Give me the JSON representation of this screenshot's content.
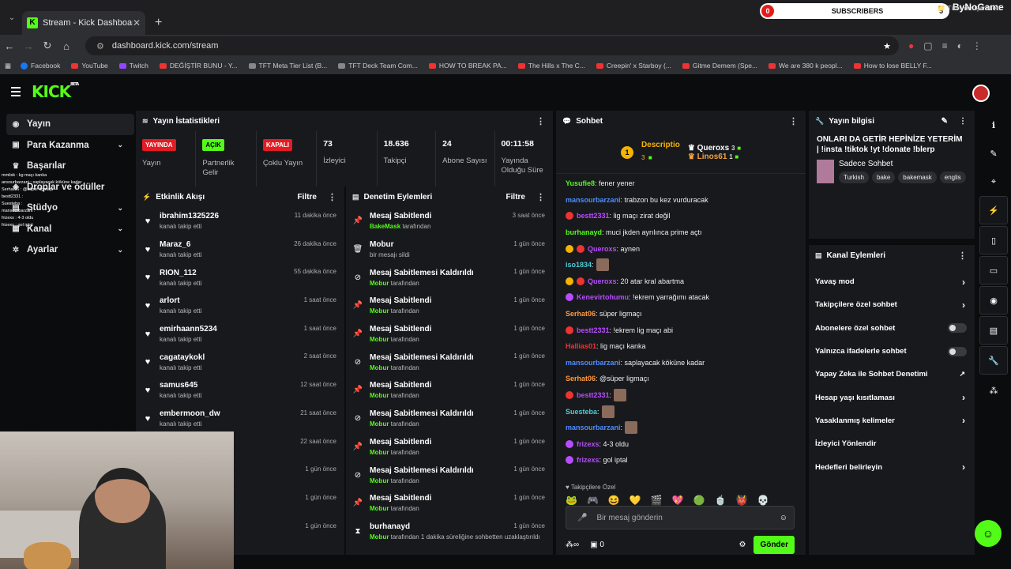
{
  "browser": {
    "tab_title": "Stream - Kick Dashboard",
    "url": "dashboard.kick.com/stream",
    "bookmarks": [
      {
        "label": "Facebook",
        "kind": "fb"
      },
      {
        "label": "YouTube",
        "kind": "yt"
      },
      {
        "label": "Twitch",
        "kind": "tw"
      },
      {
        "label": "DEĞİŞTİR BUNU - Y...",
        "kind": "yt"
      },
      {
        "label": "TFT Meta Tier List (B...",
        "kind": "gl"
      },
      {
        "label": "TFT Deck Team Com...",
        "kind": "gl"
      },
      {
        "label": "HOW TO BREAK PA...",
        "kind": "yt"
      },
      {
        "label": "The Hills x The C...",
        "kind": "yt"
      },
      {
        "label": "Creepin' x Starboy (...",
        "kind": "yt"
      },
      {
        "label": "Gitme Demem (Spe...",
        "kind": "yt"
      },
      {
        "label": "We are 380 k peopl...",
        "kind": "yt"
      },
      {
        "label": "How to lose BELLY F...",
        "kind": "yt"
      }
    ],
    "all_bookmarks": "Tüm Yer İşaretleri",
    "subs_left": "0",
    "subs_label": "SUBSCRIBERS",
    "subs_right": "5",
    "brand": "ByNoGame"
  },
  "sidebar": [
    {
      "label": "Yayın",
      "icon": "broadcast-icon",
      "glyph": "◉",
      "active": true,
      "chev": false
    },
    {
      "label": "Para Kazanma",
      "icon": "money-icon",
      "glyph": "▣",
      "chev": true
    },
    {
      "label": "Başarılar",
      "icon": "trophy-icon",
      "glyph": "♛",
      "chev": false
    },
    {
      "label": "Droplar ve ödüller",
      "icon": "gift-icon",
      "glyph": "◈",
      "chev": false
    },
    {
      "label": "Stüdyo",
      "icon": "studio-icon",
      "glyph": "▤",
      "chev": true
    },
    {
      "label": "Kanal",
      "icon": "channel-icon",
      "glyph": "▦",
      "chev": true
    },
    {
      "label": "Ayarlar",
      "icon": "settings-gear-icon",
      "glyph": "✲",
      "chev": true
    }
  ],
  "stats_panel": {
    "title": "Yayın İstatistikleri",
    "items": [
      {
        "badge": "YAYINDA",
        "color": "red",
        "label": "Yayın"
      },
      {
        "badge": "AÇIK",
        "color": "green",
        "label": "Partnerlik Gelir"
      },
      {
        "badge": "KAPALI",
        "color": "red",
        "label": "Çoklu Yayın"
      }
    ],
    "numbers": [
      {
        "value": "73",
        "label": "İzleyici"
      },
      {
        "value": "18.636",
        "label": "Takipçi"
      },
      {
        "value": "24",
        "label": "Abone Sayısı"
      },
      {
        "value": "00:11:58",
        "label": "Yayında Olduğu Süre"
      }
    ]
  },
  "activity": {
    "title": "Etkinlik Akışı",
    "filter": "Filtre",
    "items": [
      {
        "name": "ibrahim1325226",
        "sub": "kanalı takip etti",
        "time": "11 dakika önce"
      },
      {
        "name": "Maraz_6",
        "sub": "kanalı takip etti",
        "time": "26 dakika önce"
      },
      {
        "name": "RION_112",
        "sub": "kanalı takip etti",
        "time": "55 dakika önce"
      },
      {
        "name": "arlort",
        "sub": "kanalı takip etti",
        "time": "1 saat önce"
      },
      {
        "name": "emirhaann5234",
        "sub": "kanalı takip etti",
        "time": "1 saat önce"
      },
      {
        "name": "cagataykokl",
        "sub": "kanalı takip etti",
        "time": "2 saat önce"
      },
      {
        "name": "samus645",
        "sub": "kanalı takip etti",
        "time": "12 saat önce"
      },
      {
        "name": "embermoon_dw",
        "sub": "kanalı takip etti",
        "time": "21 saat önce"
      },
      {
        "name": "",
        "sub": "",
        "time": "22 saat önce"
      },
      {
        "name": "",
        "sub": "",
        "time": "1 gün önce"
      },
      {
        "name": "",
        "sub": "",
        "time": "1 gün önce"
      },
      {
        "name": "",
        "sub": "",
        "time": "1 gün önce"
      }
    ]
  },
  "moderation": {
    "title": "Denetim Eylemleri",
    "filter": "Filtre",
    "items": [
      {
        "glyph": "📌",
        "icon": "pin-icon",
        "name": "Mesaj Sabitlendi",
        "user": "BakeMask",
        "rest": " tarafından",
        "time": "3 saat önce"
      },
      {
        "glyph": "🗑",
        "icon": "trash-icon",
        "name": "Mobur",
        "user": "",
        "rest": "bir mesajı sildi",
        "time": "1 gün önce"
      },
      {
        "glyph": "⊘",
        "icon": "unpin-icon",
        "name": "Mesaj Sabitlemesi Kaldırıldı",
        "user": "Mobur",
        "rest": " tarafından",
        "time": "1 gün önce"
      },
      {
        "glyph": "📌",
        "icon": "pin-icon",
        "name": "Mesaj Sabitlendi",
        "user": "Mobur",
        "rest": " tarafından",
        "time": "1 gün önce"
      },
      {
        "glyph": "📌",
        "icon": "pin-icon",
        "name": "Mesaj Sabitlendi",
        "user": "Mobur",
        "rest": " tarafından",
        "time": "1 gün önce"
      },
      {
        "glyph": "⊘",
        "icon": "unpin-icon",
        "name": "Mesaj Sabitlemesi Kaldırıldı",
        "user": "Mobur",
        "rest": " tarafından",
        "time": "1 gün önce"
      },
      {
        "glyph": "📌",
        "icon": "pin-icon",
        "name": "Mesaj Sabitlendi",
        "user": "Mobur",
        "rest": " tarafından",
        "time": "1 gün önce"
      },
      {
        "glyph": "⊘",
        "icon": "unpin-icon",
        "name": "Mesaj Sabitlemesi Kaldırıldı",
        "user": "Mobur",
        "rest": " tarafından",
        "time": "1 gün önce"
      },
      {
        "glyph": "📌",
        "icon": "pin-icon",
        "name": "Mesaj Sabitlendi",
        "user": "Mobur",
        "rest": " tarafından",
        "time": "1 gün önce"
      },
      {
        "glyph": "⊘",
        "icon": "unpin-icon",
        "name": "Mesaj Sabitlemesi Kaldırıldı",
        "user": "Mobur",
        "rest": " tarafından",
        "time": "1 gün önce"
      },
      {
        "glyph": "📌",
        "icon": "pin-icon",
        "name": "Mesaj Sabitlendi",
        "user": "Mobur",
        "rest": " tarafından",
        "time": "1 gün önce"
      },
      {
        "glyph": "⧗",
        "icon": "timeout-icon",
        "name": "burhanayd",
        "user": "Mobur",
        "rest": " tarafından 1 dakika süreliğine sohbetten uzaklaştırıldı",
        "time": "1 gün önce"
      }
    ]
  },
  "chat": {
    "title": "Sohbet",
    "top_user1": "Descriptio",
    "top_user1_count": "3",
    "top_user2": "Queroxs",
    "top_user2_count": "3",
    "top_user3": "Linos61",
    "top_user3_count": "1",
    "messages": [
      {
        "user": "Yusufie8",
        "color": "#53fc18",
        "text": ": fener yener",
        "badges": [],
        "emote": false
      },
      {
        "user": "mansourbarzani",
        "color": "#4e8cff",
        "text": ": trabzon bu kez vurduracak",
        "badges": [],
        "emote": false
      },
      {
        "user": "bestt2331",
        "color": "#b84cff",
        "text": ": lig maçı zirat değil",
        "badges": [
          "#e33"
        ],
        "emote": false
      },
      {
        "user": "burhanayd",
        "color": "#53fc18",
        "text": ": muci jkden ayrılınca prime açtı",
        "badges": [],
        "emote": false
      },
      {
        "user": "Queroxs",
        "color": "#b84cff",
        "text": ": aynen",
        "badges": [
          "#f4b400",
          "#e33"
        ],
        "emote": false
      },
      {
        "user": "iso1834",
        "color": "#4ecbd6",
        "text": ":",
        "badges": [],
        "emote": true
      },
      {
        "user": "Queroxs",
        "color": "#b84cff",
        "text": ": 20 atar kral abartma",
        "badges": [
          "#f4b400",
          "#e33"
        ],
        "emote": false
      },
      {
        "user": "Kenevirtohumu",
        "color": "#b84cff",
        "text": ": !ekrem yarrağımı atacak",
        "badges": [
          "#b84cff"
        ],
        "emote": false
      },
      {
        "user": "Serhat06",
        "color": "#ff9a3c",
        "text": ": süper ligmaçı",
        "badges": [],
        "emote": false
      },
      {
        "user": "bestt2331",
        "color": "#b84cff",
        "text": ": !ekrem lig maçı abi",
        "badges": [
          "#e33"
        ],
        "emote": false
      },
      {
        "user": "Hallias01",
        "color": "#e33",
        "text": ": lig maçı kanka",
        "badges": [],
        "emote": false
      },
      {
        "user": "mansourbarzani",
        "color": "#4e8cff",
        "text": ": saplayacak köküne kadar",
        "badges": [],
        "emote": false
      },
      {
        "user": "Serhat06",
        "color": "#ff9a3c",
        "text": ": @süper ligmaçı",
        "badges": [],
        "emote": false
      },
      {
        "user": "bestt2331",
        "color": "#b84cff",
        "text": ":",
        "badges": [
          "#e33"
        ],
        "emote": true
      },
      {
        "user": "Suesteba",
        "color": "#4ecbd6",
        "text": ":",
        "badges": [],
        "emote": true
      },
      {
        "user": "mansourbarzani",
        "color": "#4e8cff",
        "text": ":",
        "badges": [],
        "emote": true
      },
      {
        "user": "frizexs",
        "color": "#b84cff",
        "text": ": 4-3 oldu",
        "badges": [
          "#b84cff"
        ],
        "emote": false
      },
      {
        "user": "frizexs",
        "color": "#b84cff",
        "text": ": gol iptal",
        "badges": [
          "#b84cff"
        ],
        "emote": false
      }
    ],
    "followers_only": "Takipçilere Özel",
    "input_placeholder": "Bir mesaj gönderin",
    "points": "0",
    "send": "Gönder"
  },
  "stream_info": {
    "title": "Yayın bilgisi",
    "stream_title": "ONLARI DA GETİR HEPİNİZE YETERİM | !insta !tiktok !yt !donate !blerp",
    "category": "Sadece Sohbet",
    "tags": [
      "Turkish",
      "bake",
      "bakemask",
      "englis"
    ]
  },
  "channel_actions": {
    "title": "Kanal Eylemleri",
    "items": [
      {
        "label": "Yavaş mod",
        "kind": "arrow"
      },
      {
        "label": "Takipçilere özel sohbet",
        "kind": "arrow"
      },
      {
        "label": "Abonelere özel sohbet",
        "kind": "toggle"
      },
      {
        "label": "Yalnızca ifadelerle sohbet",
        "kind": "toggle"
      },
      {
        "label": "Yapay Zeka ile Sohbet Denetimi",
        "kind": "ext"
      },
      {
        "label": "Hesap yaşı kısıtlaması",
        "kind": "arrow"
      },
      {
        "label": "Yasaklanmış kelimeler",
        "kind": "arrow"
      },
      {
        "label": "İzleyici Yönlendir",
        "kind": "none"
      },
      {
        "label": "Hedefleri belirleyin",
        "kind": "arrow"
      }
    ]
  },
  "overlay_chat": [
    "mmlisk : kg maçı kanka",
    "ansourbarzani : saplayacak köküne kadar",
    "Serhat06 : @süper ligmaçı",
    "bestt2331 :",
    "Suesteba :",
    "mansourbarzani :",
    "frizexs : 4-3 oldu",
    "frizexs : gol iptal"
  ]
}
